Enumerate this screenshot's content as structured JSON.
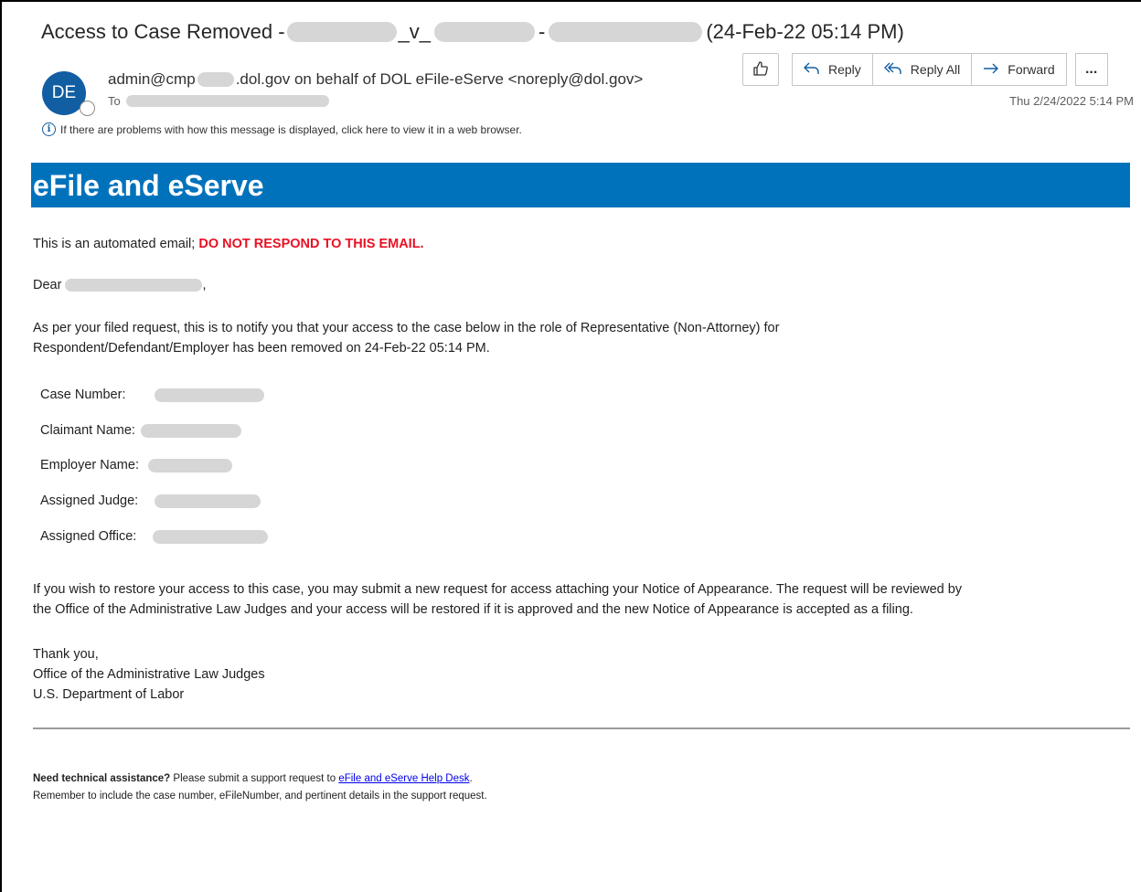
{
  "email": {
    "subject_start": "Access to Case Removed -",
    "subject_mid": "_v_",
    "subject_dash": "-",
    "subject_end": "(24-Feb-22 05:14 PM)",
    "avatar_initials": "DE",
    "sender_prefix": "admin@cmp",
    "sender_suffix": ".dol.gov",
    "sender_rest": " on behalf of DOL eFile-eServe <noreply@dol.gov>",
    "to_label": "To",
    "date": "Thu 2/24/2022 5:14 PM",
    "info_text": "If there are problems with how this message is displayed, click here to view it in a web browser."
  },
  "toolbar": {
    "like_icon": "thumbs-up-icon",
    "reply_label": "Reply",
    "reply_all_label": "Reply All",
    "forward_label": "Forward",
    "more_label": "..."
  },
  "body": {
    "banner_title": "eFile and eServe",
    "automated_prefix": "This is an automated email; ",
    "automated_warning": "DO NOT RESPOND TO THIS EMAIL.",
    "greeting": "Dear",
    "greeting_end": ",",
    "paragraph1_line1": "As per your filed request, this is to notify you that your access to the case below in the role of Representative (Non-Attorney) for",
    "paragraph1_line2": "Respondent/Defendant/Employer has been removed on 24-Feb-22 05:14 PM.",
    "details": [
      {
        "label": "Case Number:"
      },
      {
        "label": "Claimant Name:"
      },
      {
        "label": "Employer Name:"
      },
      {
        "label": "Assigned Judge:"
      },
      {
        "label": "Assigned Office:"
      }
    ],
    "paragraph2_line1": "If you wish to restore your access to this case, you may submit a new request for access attaching your Notice of Appearance. The request will be reviewed by",
    "paragraph2_line2": "the Office of the Administrative Law Judges and your access will be restored if it is approved and the new Notice of Appearance is accepted as a filing.",
    "closing": "Thank you,",
    "signature_line1": "Office of the Administrative Law Judges",
    "signature_line2": "U.S. Department of Labor"
  },
  "footer": {
    "help_bold": "Need technical assistance?",
    "help_text": " Please submit a support request to ",
    "help_link": "eFile and eServe Help Desk",
    "help_end": ".",
    "reminder": "Remember to include the case number, eFileNumber, and pertinent details in the support request."
  },
  "colors": {
    "banner": "#0072bc",
    "warning": "#e81123",
    "avatar": "#115ea3"
  }
}
